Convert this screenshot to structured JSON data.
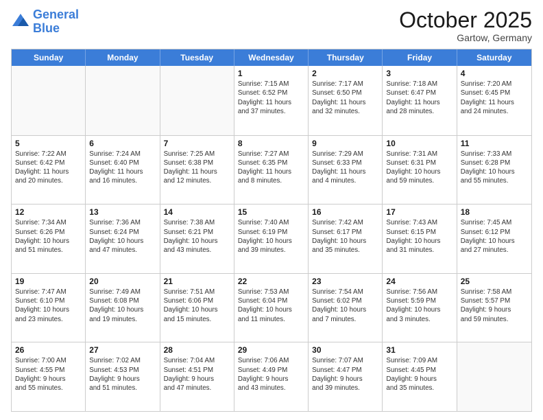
{
  "logo": {
    "line1": "General",
    "line2": "Blue"
  },
  "title": "October 2025",
  "location": "Gartow, Germany",
  "weekdays": [
    "Sunday",
    "Monday",
    "Tuesday",
    "Wednesday",
    "Thursday",
    "Friday",
    "Saturday"
  ],
  "weeks": [
    [
      {
        "day": "",
        "text": ""
      },
      {
        "day": "",
        "text": ""
      },
      {
        "day": "",
        "text": ""
      },
      {
        "day": "1",
        "text": "Sunrise: 7:15 AM\nSunset: 6:52 PM\nDaylight: 11 hours\nand 37 minutes."
      },
      {
        "day": "2",
        "text": "Sunrise: 7:17 AM\nSunset: 6:50 PM\nDaylight: 11 hours\nand 32 minutes."
      },
      {
        "day": "3",
        "text": "Sunrise: 7:18 AM\nSunset: 6:47 PM\nDaylight: 11 hours\nand 28 minutes."
      },
      {
        "day": "4",
        "text": "Sunrise: 7:20 AM\nSunset: 6:45 PM\nDaylight: 11 hours\nand 24 minutes."
      }
    ],
    [
      {
        "day": "5",
        "text": "Sunrise: 7:22 AM\nSunset: 6:42 PM\nDaylight: 11 hours\nand 20 minutes."
      },
      {
        "day": "6",
        "text": "Sunrise: 7:24 AM\nSunset: 6:40 PM\nDaylight: 11 hours\nand 16 minutes."
      },
      {
        "day": "7",
        "text": "Sunrise: 7:25 AM\nSunset: 6:38 PM\nDaylight: 11 hours\nand 12 minutes."
      },
      {
        "day": "8",
        "text": "Sunrise: 7:27 AM\nSunset: 6:35 PM\nDaylight: 11 hours\nand 8 minutes."
      },
      {
        "day": "9",
        "text": "Sunrise: 7:29 AM\nSunset: 6:33 PM\nDaylight: 11 hours\nand 4 minutes."
      },
      {
        "day": "10",
        "text": "Sunrise: 7:31 AM\nSunset: 6:31 PM\nDaylight: 10 hours\nand 59 minutes."
      },
      {
        "day": "11",
        "text": "Sunrise: 7:33 AM\nSunset: 6:28 PM\nDaylight: 10 hours\nand 55 minutes."
      }
    ],
    [
      {
        "day": "12",
        "text": "Sunrise: 7:34 AM\nSunset: 6:26 PM\nDaylight: 10 hours\nand 51 minutes."
      },
      {
        "day": "13",
        "text": "Sunrise: 7:36 AM\nSunset: 6:24 PM\nDaylight: 10 hours\nand 47 minutes."
      },
      {
        "day": "14",
        "text": "Sunrise: 7:38 AM\nSunset: 6:21 PM\nDaylight: 10 hours\nand 43 minutes."
      },
      {
        "day": "15",
        "text": "Sunrise: 7:40 AM\nSunset: 6:19 PM\nDaylight: 10 hours\nand 39 minutes."
      },
      {
        "day": "16",
        "text": "Sunrise: 7:42 AM\nSunset: 6:17 PM\nDaylight: 10 hours\nand 35 minutes."
      },
      {
        "day": "17",
        "text": "Sunrise: 7:43 AM\nSunset: 6:15 PM\nDaylight: 10 hours\nand 31 minutes."
      },
      {
        "day": "18",
        "text": "Sunrise: 7:45 AM\nSunset: 6:12 PM\nDaylight: 10 hours\nand 27 minutes."
      }
    ],
    [
      {
        "day": "19",
        "text": "Sunrise: 7:47 AM\nSunset: 6:10 PM\nDaylight: 10 hours\nand 23 minutes."
      },
      {
        "day": "20",
        "text": "Sunrise: 7:49 AM\nSunset: 6:08 PM\nDaylight: 10 hours\nand 19 minutes."
      },
      {
        "day": "21",
        "text": "Sunrise: 7:51 AM\nSunset: 6:06 PM\nDaylight: 10 hours\nand 15 minutes."
      },
      {
        "day": "22",
        "text": "Sunrise: 7:53 AM\nSunset: 6:04 PM\nDaylight: 10 hours\nand 11 minutes."
      },
      {
        "day": "23",
        "text": "Sunrise: 7:54 AM\nSunset: 6:02 PM\nDaylight: 10 hours\nand 7 minutes."
      },
      {
        "day": "24",
        "text": "Sunrise: 7:56 AM\nSunset: 5:59 PM\nDaylight: 10 hours\nand 3 minutes."
      },
      {
        "day": "25",
        "text": "Sunrise: 7:58 AM\nSunset: 5:57 PM\nDaylight: 9 hours\nand 59 minutes."
      }
    ],
    [
      {
        "day": "26",
        "text": "Sunrise: 7:00 AM\nSunset: 4:55 PM\nDaylight: 9 hours\nand 55 minutes."
      },
      {
        "day": "27",
        "text": "Sunrise: 7:02 AM\nSunset: 4:53 PM\nDaylight: 9 hours\nand 51 minutes."
      },
      {
        "day": "28",
        "text": "Sunrise: 7:04 AM\nSunset: 4:51 PM\nDaylight: 9 hours\nand 47 minutes."
      },
      {
        "day": "29",
        "text": "Sunrise: 7:06 AM\nSunset: 4:49 PM\nDaylight: 9 hours\nand 43 minutes."
      },
      {
        "day": "30",
        "text": "Sunrise: 7:07 AM\nSunset: 4:47 PM\nDaylight: 9 hours\nand 39 minutes."
      },
      {
        "day": "31",
        "text": "Sunrise: 7:09 AM\nSunset: 4:45 PM\nDaylight: 9 hours\nand 35 minutes."
      },
      {
        "day": "",
        "text": ""
      }
    ]
  ]
}
